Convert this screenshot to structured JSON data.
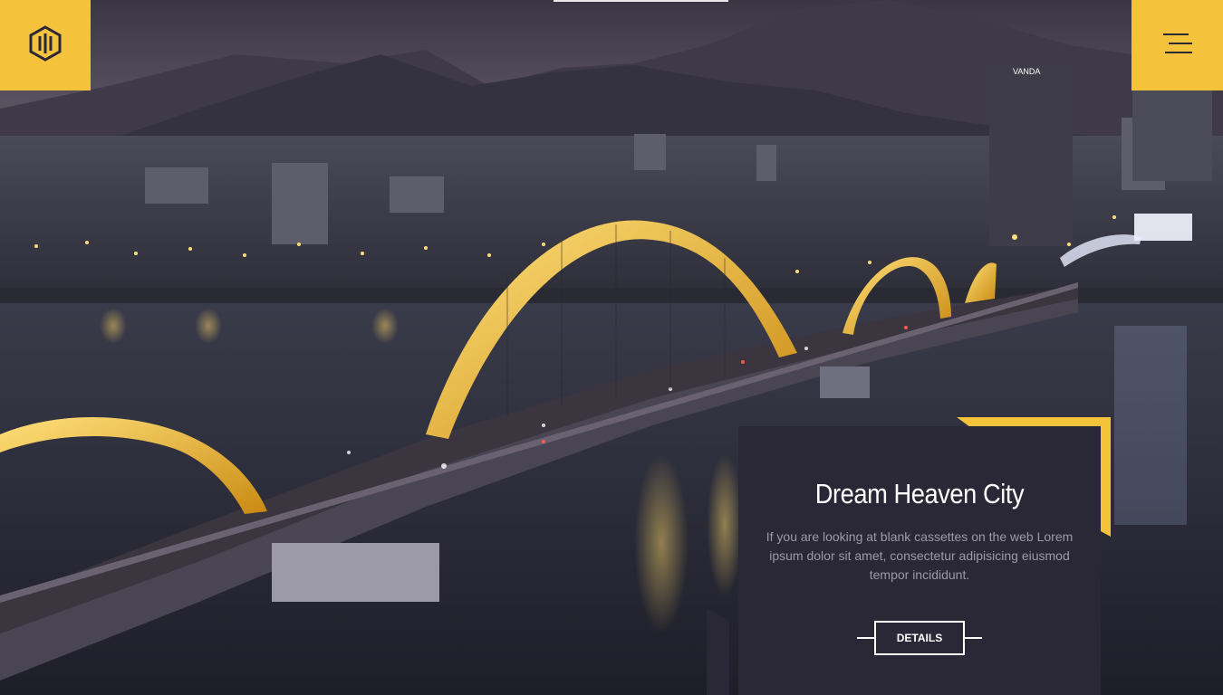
{
  "brand": {
    "logo_icon": "hexagon-logo-icon",
    "accent_color": "#f5c33b"
  },
  "header": {
    "menu_icon": "hamburger-menu-icon"
  },
  "hero": {
    "scene": "night-city-bridge"
  },
  "card": {
    "title": "Dream Heaven City",
    "description": "If you are looking at blank cassettes on the web Lorem ipsum dolor sit amet, consectetur adipisicing eiusmod tempor incididunt.",
    "button_label": "DETAILS",
    "background": "#2a2837"
  }
}
